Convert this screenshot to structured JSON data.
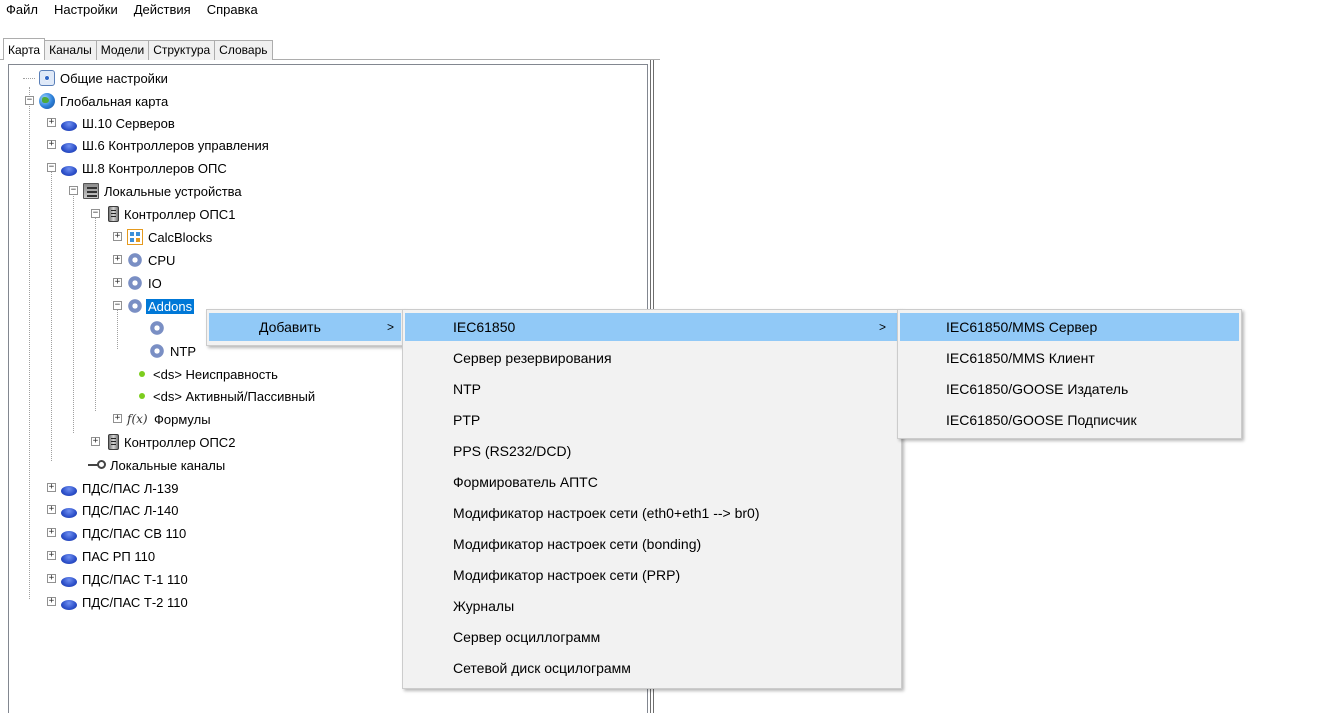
{
  "menubar": {
    "items": [
      "Файл",
      "Настройки",
      "Действия",
      "Справка"
    ]
  },
  "tabs": [
    "Карта",
    "Каналы",
    "Модели",
    "Структура",
    "Словарь"
  ],
  "active_tab": "Карта",
  "tree": {
    "general_settings": "Общие настройки",
    "global_map": "Глобальная карта",
    "sh10": "Ш.10 Серверов",
    "sh6": "Ш.6 Контроллеров управления",
    "sh8": "Ш.8 Контроллеров ОПС",
    "local_devices": "Локальные устройства",
    "controller1": "Контроллер ОПС1",
    "calcblocks": "CalcBlocks",
    "cpu": "CPU",
    "io": "IO",
    "addons": "Addons",
    "ntp": "NTP",
    "ds_fault": "<ds> Неисправность",
    "ds_active": "<ds> Активный/Пассивный",
    "formulas": "Формулы",
    "controller2": "Контроллер ОПС2",
    "local_channels": "Локальные каналы",
    "pds_l139": "ПДС/ПАС Л-139",
    "pds_l140": "ПДС/ПАС Л-140",
    "pds_sv110": "ПДС/ПАС СВ 110",
    "pas_rp110": "ПАС РП 110",
    "pds_t1": "ПДС/ПАС Т-1 110",
    "pds_t2": "ПДС/ПАС Т-2 110"
  },
  "context_menu": {
    "add": "Добавить",
    "arrow": ">"
  },
  "submenu": {
    "items": [
      "IEC61850",
      "Сервер резервирования",
      "NTP",
      "PTP",
      "PPS (RS232/DCD)",
      "Формирователь АПТС",
      "Модификатор настроек сети (eth0+eth1 --> br0)",
      "Модификатор настроек сети (bonding)",
      "Модификатор настроек сети (PRP)",
      "Журналы",
      "Сервер осциллограмм",
      "Сетевой диск осцилограмм"
    ]
  },
  "iec_submenu": {
    "items": [
      "IEC61850/MMS Сервер",
      "IEC61850/MMS Клиент",
      "IEC61850/GOOSE Издатель",
      "IEC61850/GOOSE Подписчик"
    ]
  },
  "colors": {
    "selection": "#0078d7",
    "menu_highlight": "#91c9f7",
    "menu_bg": "#f2f2f2"
  }
}
